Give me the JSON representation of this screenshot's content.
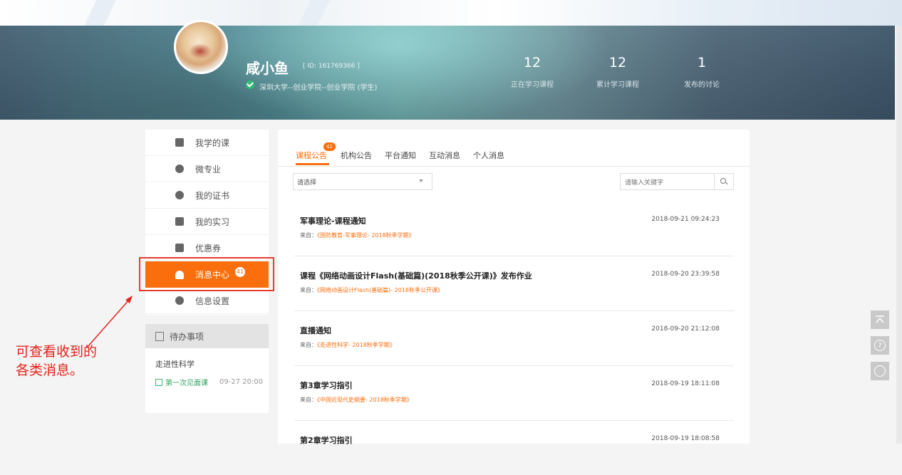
{
  "profile": {
    "name": "咸小鱼",
    "id_text": "[ ID: 161769366 ]",
    "school": "深圳大学--创业学院--创业学院 (学生)"
  },
  "stats": [
    {
      "value": "12",
      "label": "正在学习课程"
    },
    {
      "value": "12",
      "label": "累计学习课程"
    },
    {
      "value": "1",
      "label": "发布的讨论"
    }
  ],
  "sidebar": {
    "items": [
      {
        "label": "我学的课"
      },
      {
        "label": "微专业"
      },
      {
        "label": "我的证书"
      },
      {
        "label": "我的实习"
      },
      {
        "label": "优惠券"
      },
      {
        "label": "消息中心",
        "badge": "41"
      },
      {
        "label": "信息设置"
      }
    ]
  },
  "todo": {
    "title": "待办事项",
    "course": "走进性科学",
    "task": "第一次见面课",
    "time": "09-27 20:00"
  },
  "annotation": {
    "line1": "可查看收到的",
    "line2": "各类消息。"
  },
  "tabs": [
    {
      "label": "课程公告",
      "badge": "41"
    },
    {
      "label": "机构公告"
    },
    {
      "label": "平台通知"
    },
    {
      "label": "互动消息"
    },
    {
      "label": "个人消息"
    }
  ],
  "filter": {
    "select_value": "请选择",
    "search_placeholder": "请输入关键字"
  },
  "messages": [
    {
      "title": "军事理论-课程通知",
      "from_label": "来自：",
      "source": "《国防教育-军事理论- 2018秋季学期》",
      "date": "2018-09-21 09:24:23"
    },
    {
      "title": "课程《网络动画设计Flash(基础篇)(2018秋季公开课)》发布作业",
      "from_label": "来自：",
      "source": "《网络动画设计Flash(基础篇)- 2018秋季公开课》",
      "date": "2018-09-20 23:39:58"
    },
    {
      "title": "直播通知",
      "from_label": "来自：",
      "source": "《走进性科学- 2018秋季学期》",
      "date": "2018-09-20 21:12:08"
    },
    {
      "title": "第3章学习指引",
      "from_label": "来自：",
      "source": "《中国近现代史纲要- 2018秋季学期》",
      "date": "2018-09-19 18:11:08"
    },
    {
      "title": "第2章学习指引",
      "from_label": "来自：",
      "source": "",
      "date": "2018-09-19 18:08:58"
    }
  ],
  "colors": {
    "accent": "#fb6e0d",
    "annotation": "#e5231b",
    "verified": "#2fbf71"
  }
}
